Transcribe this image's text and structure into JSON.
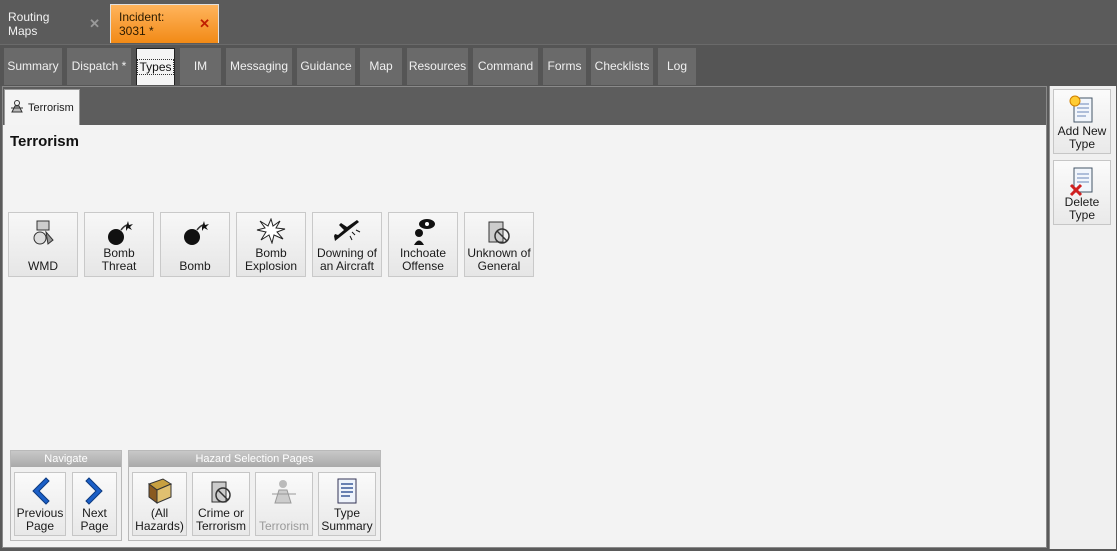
{
  "doc_tabs": [
    {
      "label": "Routing Maps",
      "close": "✕"
    },
    {
      "label": "Incident: 3031 *",
      "close": "✕"
    }
  ],
  "main_tabs": [
    "Summary",
    "Dispatch *",
    "Types",
    "IM",
    "Messaging",
    "Guidance",
    "Map",
    "Resources",
    "Command",
    "Forms",
    "Checklists",
    "Log"
  ],
  "sub_tab": {
    "label": "Terrorism"
  },
  "page_title": "Terrorism",
  "types": [
    {
      "label": "WMD",
      "icon": "wmd-icon"
    },
    {
      "label": "Bomb Threat",
      "icon": "bomb-threat-icon"
    },
    {
      "label": "Bomb",
      "icon": "bomb-icon"
    },
    {
      "label": "Bomb Explosion",
      "icon": "explosion-icon"
    },
    {
      "label": "Downing of an Aircraft",
      "icon": "downed-aircraft-icon"
    },
    {
      "label": "Inchoate Offense",
      "icon": "inchoate-icon"
    },
    {
      "label": "Unknown of General",
      "icon": "unknown-general-icon"
    }
  ],
  "navigate": {
    "title": "Navigate",
    "previous": "Previous Page",
    "next": "Next Page"
  },
  "hazard_pages": {
    "title": "Hazard Selection Pages",
    "items": [
      {
        "label": "(All Hazards)",
        "icon": "book-icon"
      },
      {
        "label": "Crime or Terrorism",
        "icon": "crime-terrorism-icon"
      },
      {
        "label": "Terrorism",
        "icon": "terrorism-icon",
        "disabled": true
      },
      {
        "label": "Type Summary",
        "icon": "summary-icon"
      }
    ]
  },
  "actions": {
    "add": "Add New Type",
    "delete": "Delete Type"
  },
  "colors": {
    "active_doc_tab": "#f28a16",
    "nav_arrow": "#1b5fc7",
    "bar_dark": "#5b5b5b"
  }
}
